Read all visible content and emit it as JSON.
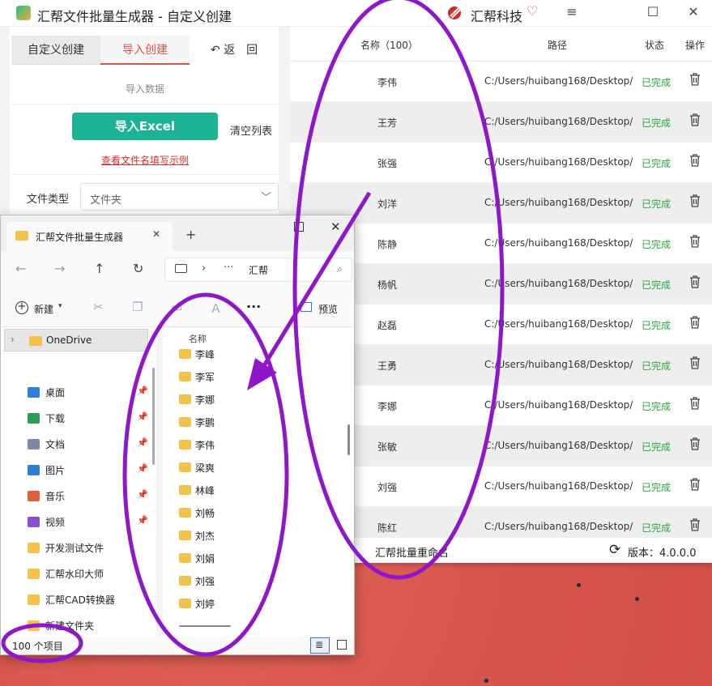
{
  "app": {
    "title": "汇帮文件批量生成器 - 自定义创建",
    "brand": "汇帮科技",
    "window_controls": {
      "menu": "≡",
      "maximize": "☐",
      "close": "✕"
    }
  },
  "left": {
    "tabs": {
      "custom": "自定义创建",
      "import": "导入创建",
      "back": "返　回"
    },
    "import_label": "导入数据",
    "import_button": "导入Excel",
    "clear_button": "清空列表",
    "example_link": "查看文件名填写示例",
    "filetype_label": "文件类型",
    "filetype_value": "文件夹"
  },
  "table": {
    "headers": {
      "name": "名称（100）",
      "path": "路径",
      "status": "状态",
      "action": "操作"
    },
    "rows": [
      {
        "name": "李伟",
        "path": "C:/Users/huibang168/Desktop/",
        "status": "已完成"
      },
      {
        "name": "王芳",
        "path": "C:/Users/huibang168/Desktop/",
        "status": "已完成"
      },
      {
        "name": "张强",
        "path": "C:/Users/huibang168/Desktop/",
        "status": "已完成"
      },
      {
        "name": "刘洋",
        "path": "C:/Users/huibang168/Desktop/",
        "status": "已完成"
      },
      {
        "name": "陈静",
        "path": "C:/Users/huibang168/Desktop/",
        "status": "已完成"
      },
      {
        "name": "杨帆",
        "path": "C:/Users/huibang168/Desktop/",
        "status": "已完成"
      },
      {
        "name": "赵磊",
        "path": "C:/Users/huibang168/Desktop/",
        "status": "已完成"
      },
      {
        "name": "王勇",
        "path": "C:/Users/huibang168/Desktop/",
        "status": "已完成"
      },
      {
        "name": "李娜",
        "path": "C:/Users/huibang168/Desktop/",
        "status": "已完成"
      },
      {
        "name": "张敏",
        "path": "C:/Users/huibang168/Desktop/",
        "status": "已完成"
      },
      {
        "name": "刘强",
        "path": "C:/Users/huibang168/Desktop/",
        "status": "已完成"
      },
      {
        "name": "陈红",
        "path": "C:/Users/huibang168/Desktop/",
        "status": "已完成"
      }
    ]
  },
  "footer": {
    "left": "汇帮批量重命名",
    "version": "版本：4.0.0.0"
  },
  "explorer": {
    "tab_title": "汇帮文件批量生成器",
    "address_path": "汇帮",
    "toolbar": {
      "new": "新建",
      "preview": "预览"
    },
    "nav": {
      "onedrive": "OneDrive",
      "items": [
        {
          "label": "桌面",
          "icon": "desktop-icon",
          "pinned": true
        },
        {
          "label": "下载",
          "icon": "download-icon",
          "pinned": true
        },
        {
          "label": "文档",
          "icon": "document-icon",
          "pinned": true
        },
        {
          "label": "图片",
          "icon": "picture-icon",
          "pinned": true
        },
        {
          "label": "音乐",
          "icon": "music-icon",
          "pinned": true
        },
        {
          "label": "视频",
          "icon": "video-icon",
          "pinned": true
        },
        {
          "label": "开发测试文件",
          "icon": "folder-icon",
          "pinned": false
        },
        {
          "label": "汇帮水印大师",
          "icon": "folder-icon",
          "pinned": false
        },
        {
          "label": "汇帮CAD转换器",
          "icon": "folder-icon",
          "pinned": false
        },
        {
          "label": "新建文件夹",
          "icon": "folder-icon",
          "pinned": false
        }
      ]
    },
    "column_header": "名称",
    "files": [
      "李峰",
      "李军",
      "李娜",
      "李鹏",
      "李伟",
      "梁爽",
      "林峰",
      "刘畅",
      "刘杰",
      "刘娟",
      "刘强",
      "刘婷"
    ],
    "status_count": "100 个项目"
  },
  "colors": {
    "accent_green": "#1cb394",
    "accent_red": "#e0534a",
    "status_done": "#27a73a",
    "annotation_purple": "#8e17c9"
  }
}
